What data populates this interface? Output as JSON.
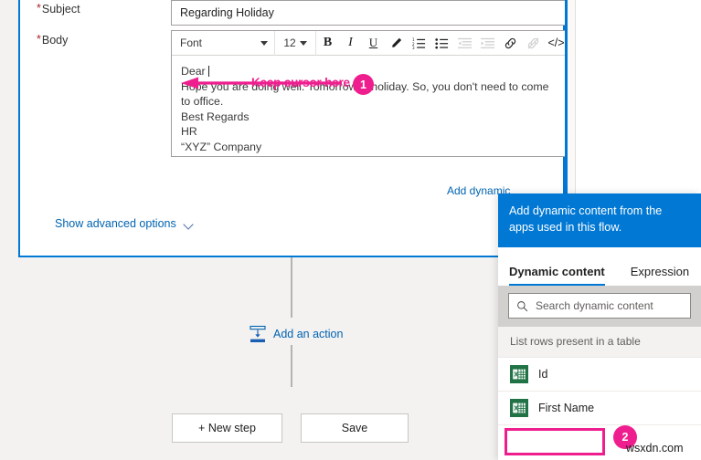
{
  "form": {
    "subject": {
      "label": "Subject",
      "required_marker": "*",
      "value": "Regarding Holiday"
    },
    "body": {
      "label": "Body",
      "required_marker": "*",
      "toolbar": {
        "font_label": "Font",
        "size_label": "12",
        "buttons": [
          {
            "name": "bold-icon",
            "glyph": "B"
          },
          {
            "name": "italic-icon",
            "glyph": "I"
          },
          {
            "name": "underline-icon",
            "glyph": "U"
          },
          {
            "name": "text-color-icon",
            "glyph": "pen"
          },
          {
            "name": "numbered-list-icon",
            "glyph": "ol"
          },
          {
            "name": "bulleted-list-icon",
            "glyph": "ul"
          },
          {
            "name": "decrease-indent-icon",
            "glyph": "outdent"
          },
          {
            "name": "increase-indent-icon",
            "glyph": "indent"
          },
          {
            "name": "insert-link-icon",
            "glyph": "link"
          },
          {
            "name": "remove-link-icon",
            "glyph": "unlink"
          },
          {
            "name": "code-view-icon",
            "glyph": "</>"
          }
        ]
      },
      "lines": [
        "Dear",
        "Hope you are doing well. Tomorrow is holiday. So, you don't need to come to office.",
        "Best Regards",
        "HR",
        "“XYZ” Company"
      ]
    },
    "add_dynamic_content_link": "Add dynamic",
    "show_advanced_options": "Show advanced options"
  },
  "designer": {
    "add_an_action": "Add an action",
    "new_step_button": "+ New step",
    "save_button": "Save"
  },
  "dynamic_panel": {
    "header_text": "Add dynamic content from the apps used in this flow.",
    "tabs": [
      {
        "label": "Dynamic content",
        "active": true
      },
      {
        "label": "Expression",
        "active": false
      }
    ],
    "search_placeholder": "Search dynamic content",
    "section_title": "List rows present in a table",
    "items": [
      {
        "label": "Id",
        "icon": "excel-icon"
      },
      {
        "label": "First Name",
        "icon": "excel-icon"
      }
    ]
  },
  "annotations": {
    "callout_text": "Keep cursor here",
    "badge_one": "1",
    "badge_two": "2",
    "accent_color": "#ef1e8f"
  },
  "watermark": "wsxdn.com"
}
